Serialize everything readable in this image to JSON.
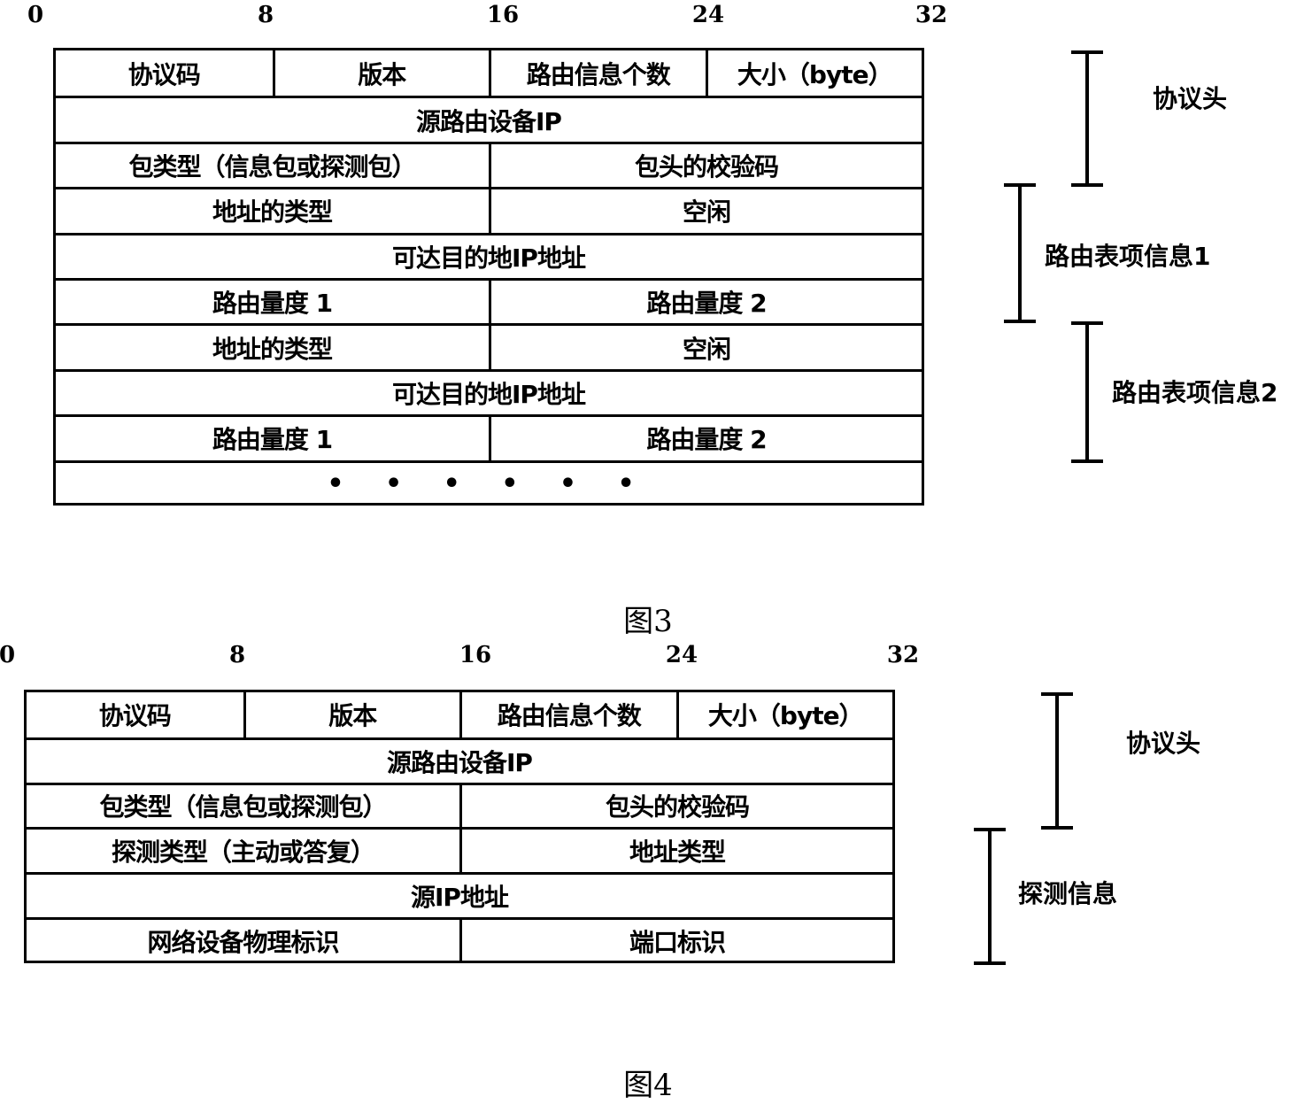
{
  "figure3": {
    "caption": "图3",
    "bit_ticks": [
      "0",
      "8",
      "16",
      "24",
      "32"
    ],
    "rows": [
      {
        "cells": [
          {
            "label": "协议码",
            "bits": 8
          },
          {
            "label": "版本",
            "bits": 8
          },
          {
            "label": "路由信息个数",
            "bits": 8
          },
          {
            "label": "大小（byte）",
            "bits": 8
          }
        ]
      },
      {
        "cells": [
          {
            "label": "源路由设备IP",
            "bits": 32
          }
        ]
      },
      {
        "cells": [
          {
            "label": "包类型（信息包或探测包）",
            "bits": 16
          },
          {
            "label": "包头的校验码",
            "bits": 16
          }
        ]
      },
      {
        "cells": [
          {
            "label": "地址的类型",
            "bits": 16
          },
          {
            "label": "空闲",
            "bits": 16
          }
        ]
      },
      {
        "cells": [
          {
            "label": "可达目的地IP地址",
            "bits": 32
          }
        ]
      },
      {
        "cells": [
          {
            "label": "路由量度 1",
            "bits": 16
          },
          {
            "label": "路由量度 2",
            "bits": 16
          }
        ]
      },
      {
        "cells": [
          {
            "label": "地址的类型",
            "bits": 16
          },
          {
            "label": "空闲",
            "bits": 16
          }
        ]
      },
      {
        "cells": [
          {
            "label": "可达目的地IP地址",
            "bits": 32
          }
        ]
      },
      {
        "cells": [
          {
            "label": "路由量度 1",
            "bits": 16
          },
          {
            "label": "路由量度 2",
            "bits": 16
          }
        ]
      },
      {
        "cells": [
          {
            "label": "• • • • • •",
            "bits": 32
          }
        ]
      }
    ],
    "brackets": [
      {
        "label": "协议头",
        "rows": "1-3"
      },
      {
        "label": "路由表项信息1",
        "rows": "4-6"
      },
      {
        "label": "路由表项信息2",
        "rows": "7-9"
      }
    ]
  },
  "figure4": {
    "caption": "图4",
    "bit_ticks": [
      "0",
      "8",
      "16",
      "24",
      "32"
    ],
    "rows": [
      {
        "cells": [
          {
            "label": "协议码",
            "bits": 8
          },
          {
            "label": "版本",
            "bits": 8
          },
          {
            "label": "路由信息个数",
            "bits": 8
          },
          {
            "label": "大小（byte）",
            "bits": 8
          }
        ]
      },
      {
        "cells": [
          {
            "label": "源路由设备IP",
            "bits": 32
          }
        ]
      },
      {
        "cells": [
          {
            "label": "包类型（信息包或探测包）",
            "bits": 16
          },
          {
            "label": "包头的校验码",
            "bits": 16
          }
        ]
      },
      {
        "cells": [
          {
            "label": "探测类型（主动或答复）",
            "bits": 16
          },
          {
            "label": "地址类型",
            "bits": 16
          }
        ]
      },
      {
        "cells": [
          {
            "label": "源IP地址",
            "bits": 32
          }
        ]
      },
      {
        "cells": [
          {
            "label": "网络设备物理标识",
            "bits": 16
          },
          {
            "label": "端口标识",
            "bits": 16
          }
        ]
      }
    ],
    "brackets": [
      {
        "label": "协议头",
        "rows": "1-3"
      },
      {
        "label": "探测信息",
        "rows": "4-6"
      }
    ]
  }
}
